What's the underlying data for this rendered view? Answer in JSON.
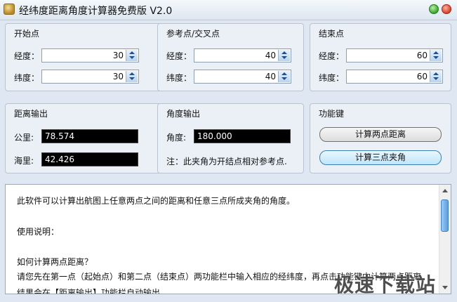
{
  "window": {
    "title": "经纬度距离角度计算器免费版 V2.0"
  },
  "start_point": {
    "title": "开始点",
    "longitude_label": "经度：",
    "longitude_value": "30",
    "latitude_label": "纬度：",
    "latitude_value": "30"
  },
  "reference_point": {
    "title": "参考点/交叉点",
    "longitude_label": "经度：",
    "longitude_value": "40",
    "latitude_label": "纬度：",
    "latitude_value": "40"
  },
  "end_point": {
    "title": "结束点",
    "longitude_label": "经度：",
    "longitude_value": "60",
    "latitude_label": "纬度：",
    "latitude_value": "60"
  },
  "distance_output": {
    "title": "距离输出",
    "km_label": "公里:",
    "km_value": "78.574",
    "nmi_label": "海里:",
    "nmi_value": "42.426"
  },
  "angle_output": {
    "title": "角度输出",
    "angle_label": "角度:",
    "angle_value": "180.000",
    "note": "注：此夹角为开结点相对参考点."
  },
  "functions": {
    "title": "功能键",
    "two_point_button": "计算两点距离",
    "three_point_button": "计算三点夹角"
  },
  "instructions": {
    "lines": [
      "此软件可以计算出航图上任意两点之间的距离和任意三点所成夹角的角度。",
      "使用说明：",
      "如何计算两点距离？",
      "请您先在第一点（起始点）和第二点（结束点）两功能栏中输入相应的经纬度，再点击功能键中计算两点距离",
      "结果会在【距离输出】功能栏自动输出"
    ]
  },
  "watermark": "极速下载站",
  "colors": {
    "output_bg": "#000000",
    "output_text": "#ffffff",
    "scroll_thumb": "#5a9fe0"
  }
}
